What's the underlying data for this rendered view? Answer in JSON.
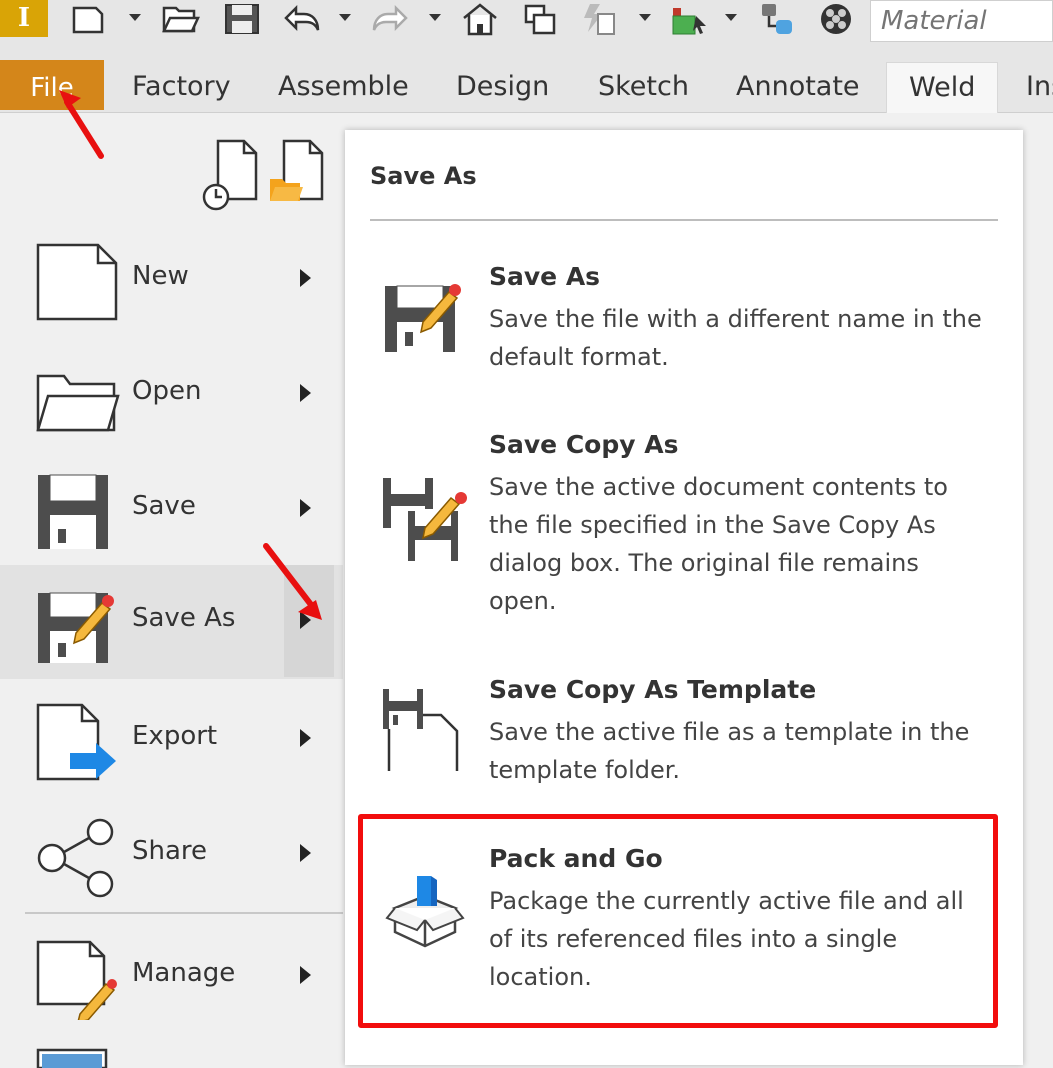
{
  "app": {
    "logo_letter": "I"
  },
  "quick_access": {
    "icons": [
      "new-icon",
      "dropdown-icon",
      "open-icon",
      "save-icon",
      "undo-icon",
      "dropdown-icon",
      "redo-icon",
      "dropdown-icon",
      "home-icon",
      "windows-icon",
      "update-icon",
      "dropdown-icon",
      "select-icon",
      "dropdown-icon",
      "ilogic-icon",
      "appearance-icon"
    ],
    "material_placeholder": "Material"
  },
  "ribbon": {
    "tabs": [
      {
        "label": "File"
      },
      {
        "label": "Factory"
      },
      {
        "label": "Assemble"
      },
      {
        "label": "Design"
      },
      {
        "label": "Sketch"
      },
      {
        "label": "Annotate"
      },
      {
        "label": "Weld"
      },
      {
        "label": "Ins"
      }
    ],
    "active_tab": "Weld"
  },
  "file_menu": {
    "top_icons": [
      "recent-documents-icon",
      "open-folder-icon"
    ],
    "items": [
      {
        "label": "New",
        "icon": "new-document-icon"
      },
      {
        "label": "Open",
        "icon": "open-folder-icon"
      },
      {
        "label": "Save",
        "icon": "save-floppy-icon"
      },
      {
        "label": "Save As",
        "icon": "save-as-icon"
      },
      {
        "label": "Export",
        "icon": "export-icon"
      },
      {
        "label": "Share",
        "icon": "share-icon"
      },
      {
        "label": "Manage",
        "icon": "manage-icon"
      }
    ],
    "selected_item": "Save As"
  },
  "submenu": {
    "title": "Save As",
    "items": [
      {
        "title": "Save As",
        "description": "Save the file with a different name in the default format.",
        "icon": "save-as-icon"
      },
      {
        "title": "Save Copy As",
        "description": "Save the active document contents to the file specified in the Save Copy As dialog box. The original file remains open.",
        "icon": "save-copy-as-icon"
      },
      {
        "title": "Save Copy As Template",
        "description": "Save the active file as a template in the template folder.",
        "icon": "save-template-icon"
      },
      {
        "title": "Pack and Go",
        "description": "Package the currently active file and all of its referenced files into a single location.",
        "icon": "pack-and-go-icon"
      }
    ],
    "highlighted_item": "Pack and Go"
  },
  "colors": {
    "file_tab": "#d4861a",
    "logo": "#d9a406",
    "annotation_red": "#f20d0d",
    "selected_bg": "#e2e2e2",
    "export_arrow": "#1e88e5"
  }
}
